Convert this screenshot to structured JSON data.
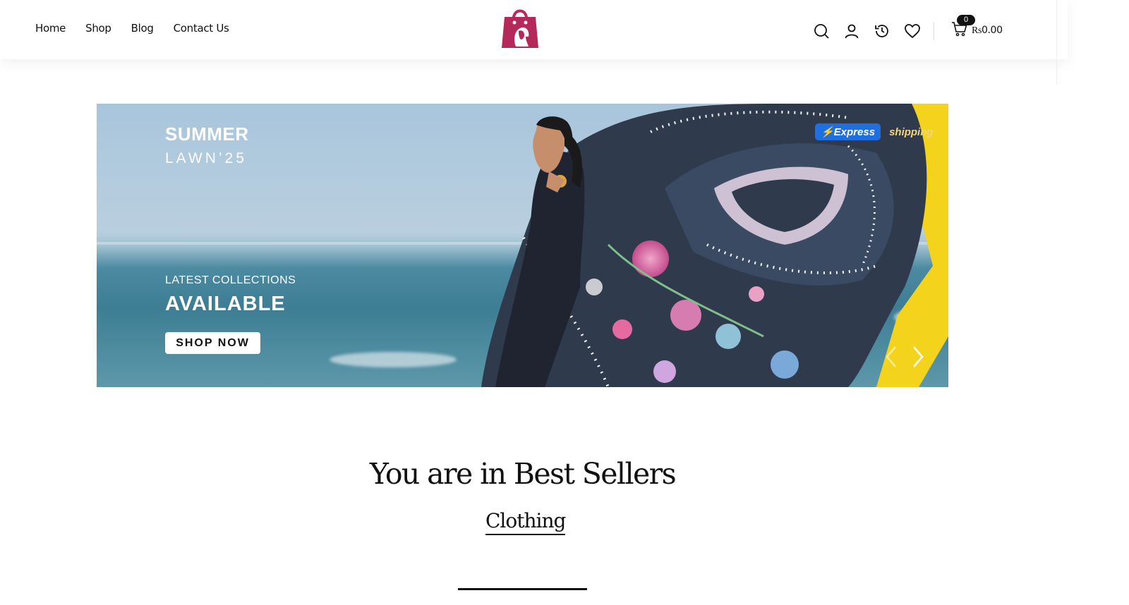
{
  "nav": [
    "Home",
    "Shop",
    "Blog",
    "Contact Us"
  ],
  "brand": {
    "color": "#b5285a",
    "logo": "shopping-bag-woman-logo"
  },
  "header_icons": [
    "search-icon",
    "user-icon",
    "history-icon",
    "heart-icon",
    "cart-icon"
  ],
  "cart": {
    "count": "0",
    "currency": "Rs",
    "total": "0.00"
  },
  "hero": {
    "title": "SUMMER",
    "subtitle": "LAWN’25",
    "tagline": "LATEST COLLECTIONS",
    "headline": "AVAILABLE",
    "cta": "SHOP NOW",
    "badge": "⚡Express",
    "badge_suffix": "shipping"
  },
  "section": {
    "title": "You are in Best Sellers",
    "tab": "Clothing"
  }
}
